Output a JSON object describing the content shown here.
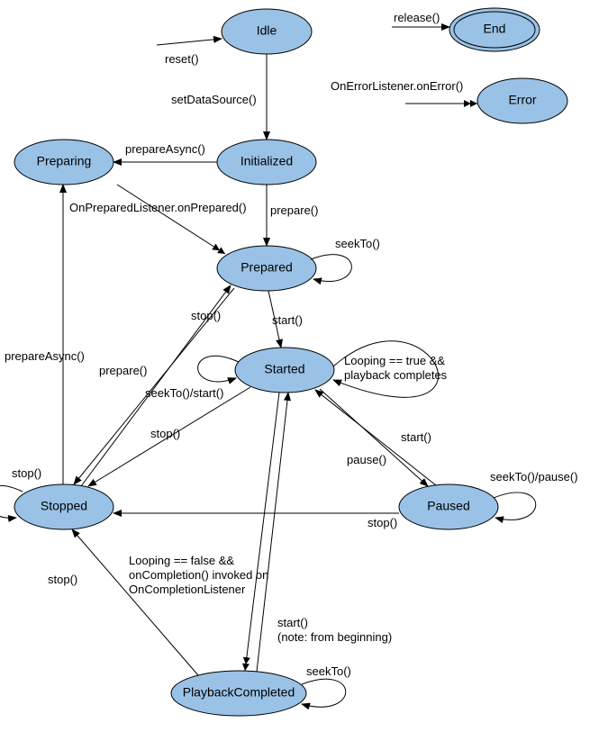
{
  "states": {
    "idle": "Idle",
    "end": "End",
    "error": "Error",
    "initialized": "Initialized",
    "preparing": "Preparing",
    "prepared": "Prepared",
    "started": "Started",
    "stopped": "Stopped",
    "paused": "Paused",
    "playbackCompleted": "PlaybackCompleted"
  },
  "transitions": {
    "reset": "reset()",
    "release": "release()",
    "setDataSource": "setDataSource()",
    "onErrorListener": "OnErrorListener.onError()",
    "prepareAsync": "prepareAsync()",
    "prepare": "prepare()",
    "onPreparedListener": "OnPreparedListener.onPrepared()",
    "seekTo": "seekTo()",
    "start": "start()",
    "stop": "stop()",
    "pause": "pause()",
    "seekToStart": "seekTo()/start()",
    "seekToPause": "seekTo()/pause()",
    "loopingTrue": "Looping == true &&",
    "playbackCompletes": "playback completes",
    "loopingFalse": "Looping == false &&",
    "onCompletionInvoked": "onCompletion() invoked on",
    "onCompletionListener": "OnCompletionListener",
    "startNote": "(note: from beginning)"
  }
}
